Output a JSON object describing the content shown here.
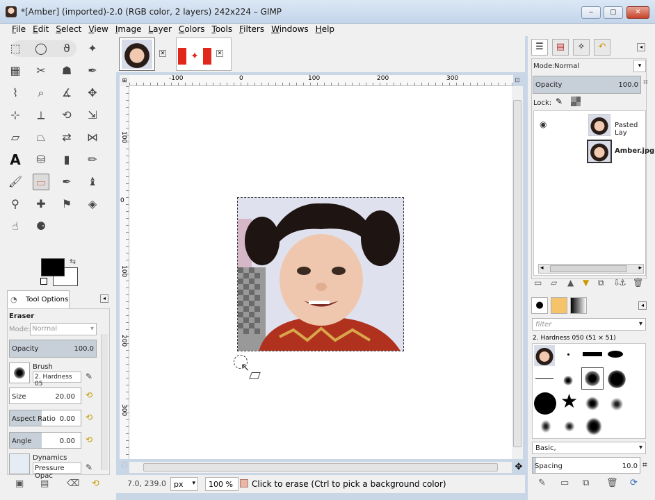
{
  "window": {
    "title": "*[Amber] (imported)-2.0 (RGB color, 2 layers) 242x224 – GIMP",
    "controls": {
      "minimize": "‒",
      "maximize": "▢",
      "close": "✕"
    }
  },
  "menubar": {
    "items": [
      "File",
      "Edit",
      "Select",
      "View",
      "Image",
      "Layer",
      "Colors",
      "Tools",
      "Filters",
      "Windows",
      "Help"
    ]
  },
  "toolbox": {
    "tools": [
      "rect-select-icon",
      "ellipse-select-icon",
      "free-select-icon",
      "fuzzy-select-icon",
      "select-by-color-icon",
      "scissors-icon",
      "foreground-select-icon",
      "paths-icon",
      "color-picker-icon",
      "zoom-icon",
      "measure-icon",
      "move-icon",
      "align-icon",
      "crop-icon",
      "rotate-icon",
      "scale-icon",
      "shear-icon",
      "perspective-icon",
      "flip-icon",
      "cage-icon",
      "text-icon",
      "bucket-fill-icon",
      "blend-icon",
      "pencil-icon",
      "paintbrush-icon",
      "eraser-icon",
      "airbrush-icon",
      "ink-icon",
      "clone-icon",
      "heal-icon",
      "perspective-clone-icon",
      "blur-icon",
      "smudge-icon",
      "dodge-burn-icon"
    ],
    "active_tool": "eraser-icon"
  },
  "tool_options": {
    "tab_label": "Tool Options",
    "tool_name": "Eraser",
    "mode_label": "Mode:",
    "mode_value": "Normal",
    "opacity_label": "Opacity",
    "opacity_value": "100.0",
    "brush_label": "Brush",
    "brush_value": "2. Hardness 05",
    "size_label": "Size",
    "size_value": "20.00",
    "aspect_label": "Aspect Ratio",
    "aspect_value": "0.00",
    "angle_label": "Angle",
    "angle_value": "0.00",
    "dynamics_label": "Dynamics",
    "dynamics_value": "Pressure Opac"
  },
  "ruler": {
    "top_labels": [
      "-100",
      "0",
      "100",
      "200",
      "300"
    ],
    "left_labels": [
      "100",
      "0",
      "100",
      "200",
      "300"
    ]
  },
  "statusbar": {
    "coords": "7.0, 239.0",
    "unit": "px",
    "zoom": "100 %",
    "message": "Click to erase (Ctrl to pick a background color)"
  },
  "layers": {
    "mode_label": "Mode:",
    "mode_value": "Normal",
    "opacity_label": "Opacity",
    "opacity_value": "100.0",
    "lock_label": "Lock:",
    "items": [
      {
        "name": "Pasted Lay",
        "visible": true
      },
      {
        "name": "Amber.jpg",
        "visible": false
      }
    ]
  },
  "brushes": {
    "filter_placeholder": "filter",
    "selected_label": "2. Hardness 050 (51 × 51)",
    "preset_value": "Basic,",
    "spacing_label": "Spacing",
    "spacing_value": "10.0"
  }
}
